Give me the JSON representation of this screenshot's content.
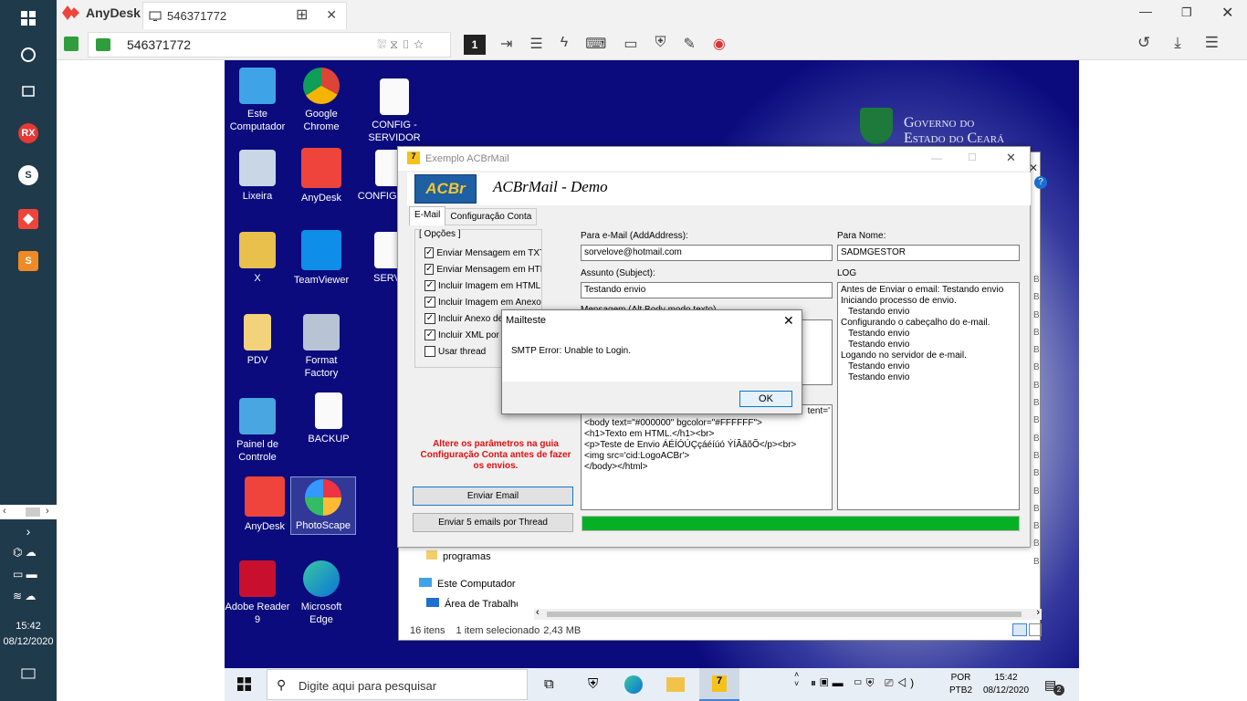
{
  "left_taskbar": {
    "clock_time": "15:42",
    "clock_date": "08/12/2020",
    "rx_label": "RX",
    "s_label": "S"
  },
  "anydesk": {
    "app_name": "AnyDesk",
    "tab_title": "546371772",
    "address": "546371772",
    "monitor_number": "1",
    "brand_color": "#ef443b"
  },
  "desktop": {
    "icons": [
      {
        "label": "Este Computador"
      },
      {
        "label": "Google Chrome"
      },
      {
        "label": "CONFIG - SERVIDOR"
      },
      {
        "label": "Lixeira"
      },
      {
        "label": "AnyDesk"
      },
      {
        "label": "CONFIG PDV"
      },
      {
        "label": "X"
      },
      {
        "label": "TeamViewer"
      },
      {
        "label": "SERV"
      },
      {
        "label": "PDV"
      },
      {
        "label": "Format Factory"
      },
      {
        "label": "Painel de Controle"
      },
      {
        "label": "BACKUP"
      },
      {
        "label": "AnyDesk"
      },
      {
        "label": "PhotoScape"
      },
      {
        "label": "Adobe Reader 9"
      },
      {
        "label": "Microsoft Edge"
      }
    ],
    "gov_text_1": "Governo do",
    "gov_text_2": "Estado do Ceará"
  },
  "acbr": {
    "window_title": "Exemplo ACBrMail",
    "header_title": "ACBrMail - Demo",
    "logo_text": "ACBr",
    "tabs": [
      "E-Mail",
      "Configuração Conta"
    ],
    "options_group": "[ Opções ]",
    "options": [
      {
        "label": "Enviar Mensagem em TXT",
        "checked": true
      },
      {
        "label": "Enviar Mensagem em HTML",
        "checked": true
      },
      {
        "label": "Incluir Imagem em HTML",
        "checked": true
      },
      {
        "label": "Incluir Imagem em Anexo",
        "checked": true
      },
      {
        "label": "Incluir Anexo de",
        "checked": true
      },
      {
        "label": "Incluir XML por S",
        "checked": true
      },
      {
        "label": "Usar thread",
        "checked": false
      }
    ],
    "to_email_label": "Para e-Mail (AddAddress):",
    "to_email_value": "sorvelove@hotmail.com",
    "to_name_label": "Para Nome:",
    "to_name_value": "SADMGESTOR",
    "subject_label": "Assunto (Subject):",
    "subject_value": "Testando envio",
    "message_label": "Mensagem (Alt Body modo texto)",
    "log_label": "LOG",
    "log_lines": [
      "Antes de Enviar o email: Testando envio",
      "Iniciando processo de envio.",
      "   Testando envio",
      "Configurando o cabeçalho do e-mail.",
      "   Testando envio",
      "   Testando envio",
      "Logando no servidor de e-mail.",
      "   Testando envio",
      "   Testando envio"
    ],
    "html_fragment": "tent='",
    "html_lines": [
      "<body text=\"#000000\" bgcolor=\"#FFFFFF\">",
      "<h1>Texto em HTML.</h1><br>",
      "<p>Teste de Envio ÁÉÍÓÚÇçáéíúó ÝÍÃãõÕ</p><br>",
      "<img src='cid:LogoACBr'>",
      "</body></html>"
    ],
    "warning_text": "Altere os parâmetros na guia Configuração Conta antes de fazer os envios.",
    "send_button": "Enviar Email",
    "send5_button": "Enviar 5 emails por Thread",
    "progress": 1.0
  },
  "dialog": {
    "title": "Mailteste",
    "message": "SMTP Error: Unable to Login.",
    "ok": "OK"
  },
  "explorer": {
    "items": [
      "programas",
      "Este Computador",
      "Área de Trabalho"
    ],
    "status_count": "16 itens",
    "status_selected": "1 item selecionado",
    "status_size": "2,43 MB",
    "side_letters": [
      "B",
      "B",
      "B",
      "B",
      "B",
      "B",
      "B",
      "B",
      "B",
      "B",
      "B",
      "B",
      "B",
      "B",
      "B",
      "B",
      "B"
    ]
  },
  "taskbar": {
    "search_placeholder": "Digite aqui para pesquisar",
    "lang_1": "POR",
    "lang_2": "PTB2",
    "time": "15:42",
    "date": "08/12/2020",
    "notification_count": "2"
  }
}
